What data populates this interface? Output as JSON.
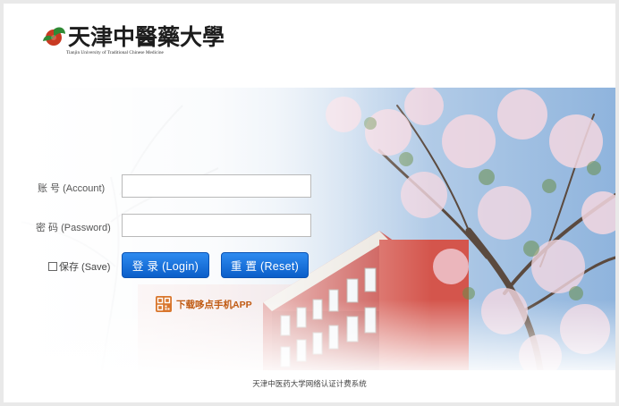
{
  "header": {
    "logo_cn": "天津中醫藥大學",
    "logo_en": "Tianjin University of Traditional Chinese Medicine"
  },
  "form": {
    "account_label": "账  号 (Account)",
    "account_value": "",
    "password_label": "密  码 (Password)",
    "password_value": "",
    "remember_label": "保存 (Save)",
    "login_label": "登 录 (Login)",
    "reset_label": "重 置 (Reset)"
  },
  "app_link": {
    "label": "下载哆点手机APP",
    "icon": "qr-code-icon"
  },
  "footer": {
    "text": "天津中医药大学网络认证计费系统"
  },
  "colors": {
    "button": "#1670dc",
    "app_link": "#c05a12"
  }
}
